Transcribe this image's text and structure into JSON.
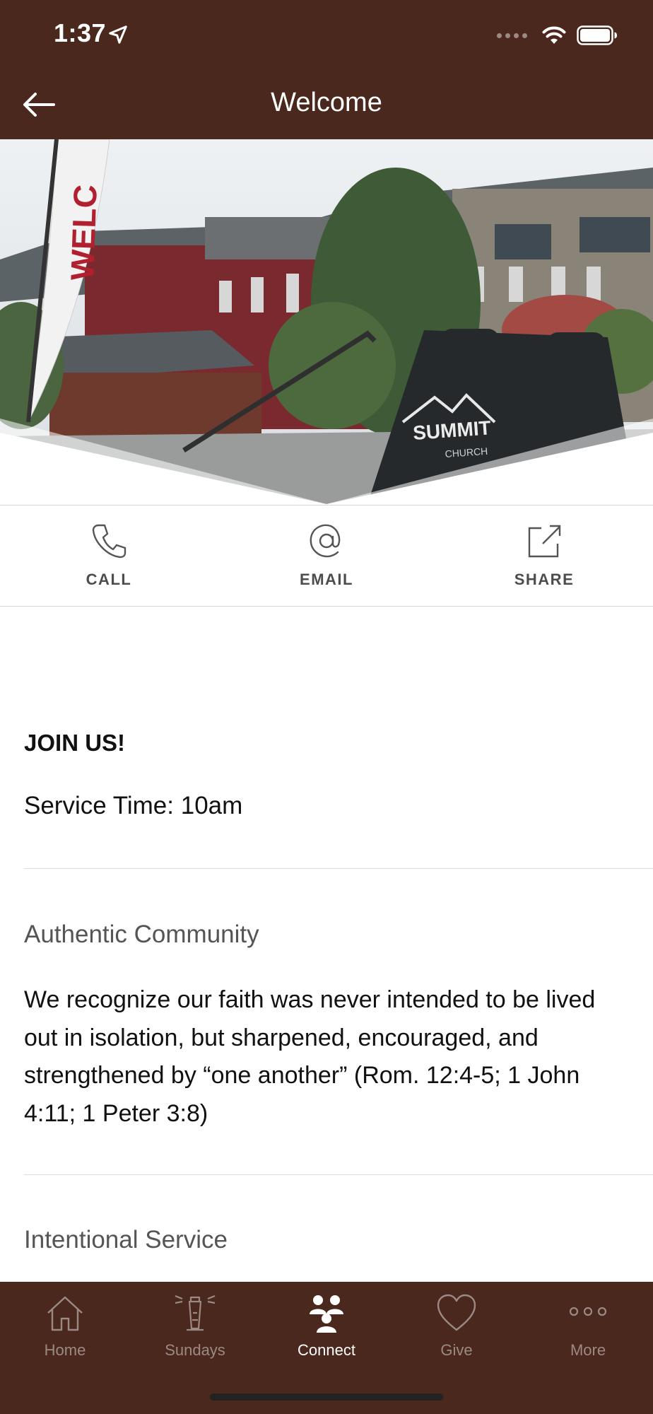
{
  "status_bar": {
    "time": "1:37"
  },
  "nav": {
    "title": "Welcome"
  },
  "hero": {
    "sign_text": "SUMMIT",
    "sign_subtext": "CHURCH",
    "flag_text": "WELC"
  },
  "actions": [
    {
      "label": "CALL",
      "icon": "phone-icon"
    },
    {
      "label": "EMAIL",
      "icon": "at-icon"
    },
    {
      "label": "SHARE",
      "icon": "share-icon"
    }
  ],
  "content": {
    "join_heading": "JOIN US!",
    "service_time": "Service Time: 10am",
    "sections": [
      {
        "heading": "Authentic Community",
        "body": "We recognize our faith was never intended to be lived out in isolation, but sharpened, encouraged, and strengthened by “one another” (Rom. 12:4-5; 1 John 4:11; 1 Peter 3:8)"
      },
      {
        "heading": "Intentional Service"
      }
    ]
  },
  "tabbar": {
    "active": "Connect",
    "items": [
      {
        "label": "Home",
        "icon": "home-icon"
      },
      {
        "label": "Sundays",
        "icon": "lighthouse-icon"
      },
      {
        "label": "Connect",
        "icon": "people-icon"
      },
      {
        "label": "Give",
        "icon": "heart-icon"
      },
      {
        "label": "More",
        "icon": "more-dots-icon"
      }
    ]
  },
  "colors": {
    "brand": "#4a281d",
    "tab_inactive": "#9b8a84",
    "text": "#111111",
    "subheading": "#555555"
  }
}
